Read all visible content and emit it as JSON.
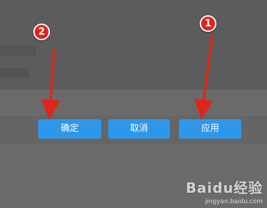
{
  "footer": {
    "buttons": [
      {
        "label": "确定"
      },
      {
        "label": "取消"
      },
      {
        "label": "应用"
      }
    ]
  },
  "annotations": {
    "step_1": "1",
    "step_2": "2",
    "arrow_color": "#e0251c"
  },
  "colors": {
    "button_bg": "#2f97ea",
    "overlay": "#5c5c5c"
  },
  "watermark": {
    "logo": "Baidu经验",
    "url": "jingyan.baidu.com"
  }
}
